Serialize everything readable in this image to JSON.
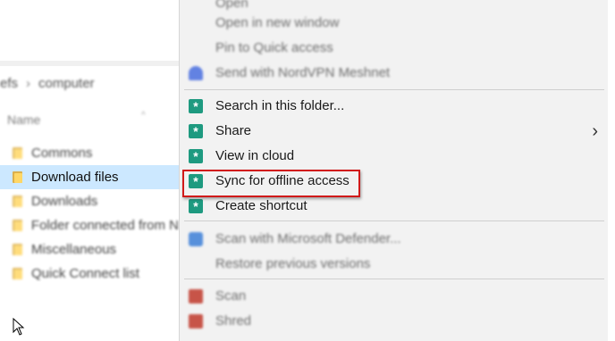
{
  "explorer": {
    "breadcrumb": [
      "efs",
      "computer"
    ],
    "column_name": "Name",
    "files": [
      {
        "name": "Commons",
        "selected": false,
        "blurred": true
      },
      {
        "name": "Download files",
        "selected": true,
        "blurred": false
      },
      {
        "name": "Downloads",
        "selected": false,
        "blurred": true
      },
      {
        "name": "Folder connected from N",
        "selected": false,
        "blurred": true
      },
      {
        "name": "Miscellaneous",
        "selected": false,
        "blurred": true
      },
      {
        "name": "Quick Connect list",
        "selected": false,
        "blurred": true
      }
    ]
  },
  "context_menu": {
    "items_top": [
      {
        "label": "Open",
        "icon": "none",
        "blurred": true
      },
      {
        "label": "Open in new window",
        "icon": "none",
        "blurred": true
      },
      {
        "label": "Pin to Quick access",
        "icon": "none",
        "blurred": true
      },
      {
        "label": "Send with NordVPN Meshnet",
        "icon": "nordvpn-icon",
        "blurred": true
      }
    ],
    "items_main": [
      {
        "label": "Search in this folder...",
        "icon": "app-star-icon"
      },
      {
        "label": "Share",
        "icon": "app-star-icon",
        "submenu": true
      },
      {
        "label": "View in cloud",
        "icon": "app-star-icon"
      },
      {
        "label": "Sync for offline access",
        "icon": "app-star-icon",
        "highlighted": true
      },
      {
        "label": "Create shortcut",
        "icon": "app-star-icon"
      }
    ],
    "items_bottom": [
      {
        "label": "Scan with Microsoft Defender...",
        "icon": "defender-shield-icon",
        "blurred": true
      },
      {
        "label": "Restore previous versions",
        "icon": "none",
        "blurred": true
      },
      {
        "label": "Scan",
        "icon": "red-app-icon",
        "blurred": true
      },
      {
        "label": "Shred",
        "icon": "red-app-icon",
        "blurred": true
      }
    ],
    "submenu_glyph": "›",
    "highlight_color": "#d11a1a",
    "accent_color": "#1e9a80"
  }
}
